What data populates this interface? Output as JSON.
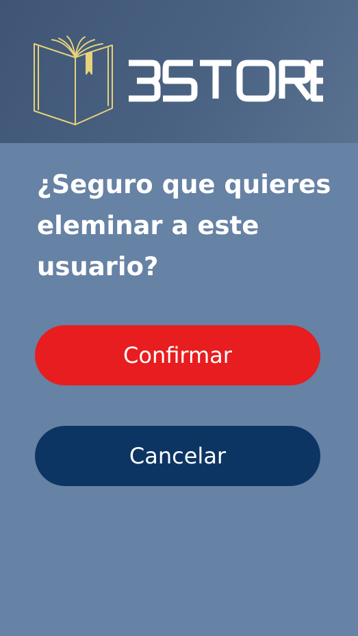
{
  "header": {
    "logo_icon": "open-book-icon",
    "brand_text": "BSTORE",
    "logo_color": "#e8d27a",
    "brand_color": "#ffffff"
  },
  "dialog": {
    "question": "¿Seguro que quieres eleminar a este usuario?",
    "confirm_label": "Confirmar",
    "cancel_label": "Cancelar"
  },
  "colors": {
    "background": "#6682a5",
    "header": "#4a6282",
    "confirm": "#e81d1f",
    "cancel": "#0d3563"
  }
}
